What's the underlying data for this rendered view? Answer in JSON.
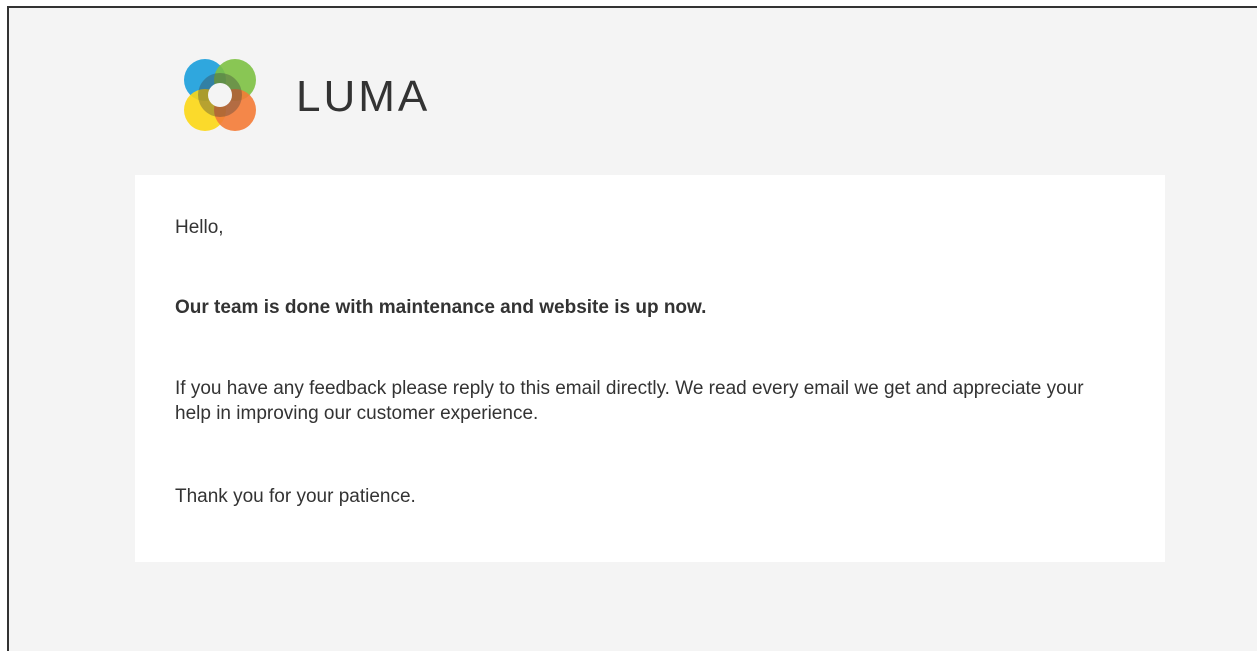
{
  "brand": {
    "name": "LUMA",
    "logo_icon": "luma-logo-icon",
    "colors": {
      "blue": "#1a9fdb",
      "green": "#7dc143",
      "yellow": "#fcd715",
      "orange": "#f47b36",
      "text": "#333333"
    }
  },
  "email": {
    "greeting": "Hello,",
    "headline": "Our team is done with maintenance and website is up now.",
    "feedback": "If you have any feedback please reply to this email directly. We read every email we get and appreciate your help in improving our customer experience.",
    "closing": "Thank you for your patience."
  },
  "theme": {
    "page_background": "#f4f4f4",
    "card_background": "#ffffff"
  }
}
